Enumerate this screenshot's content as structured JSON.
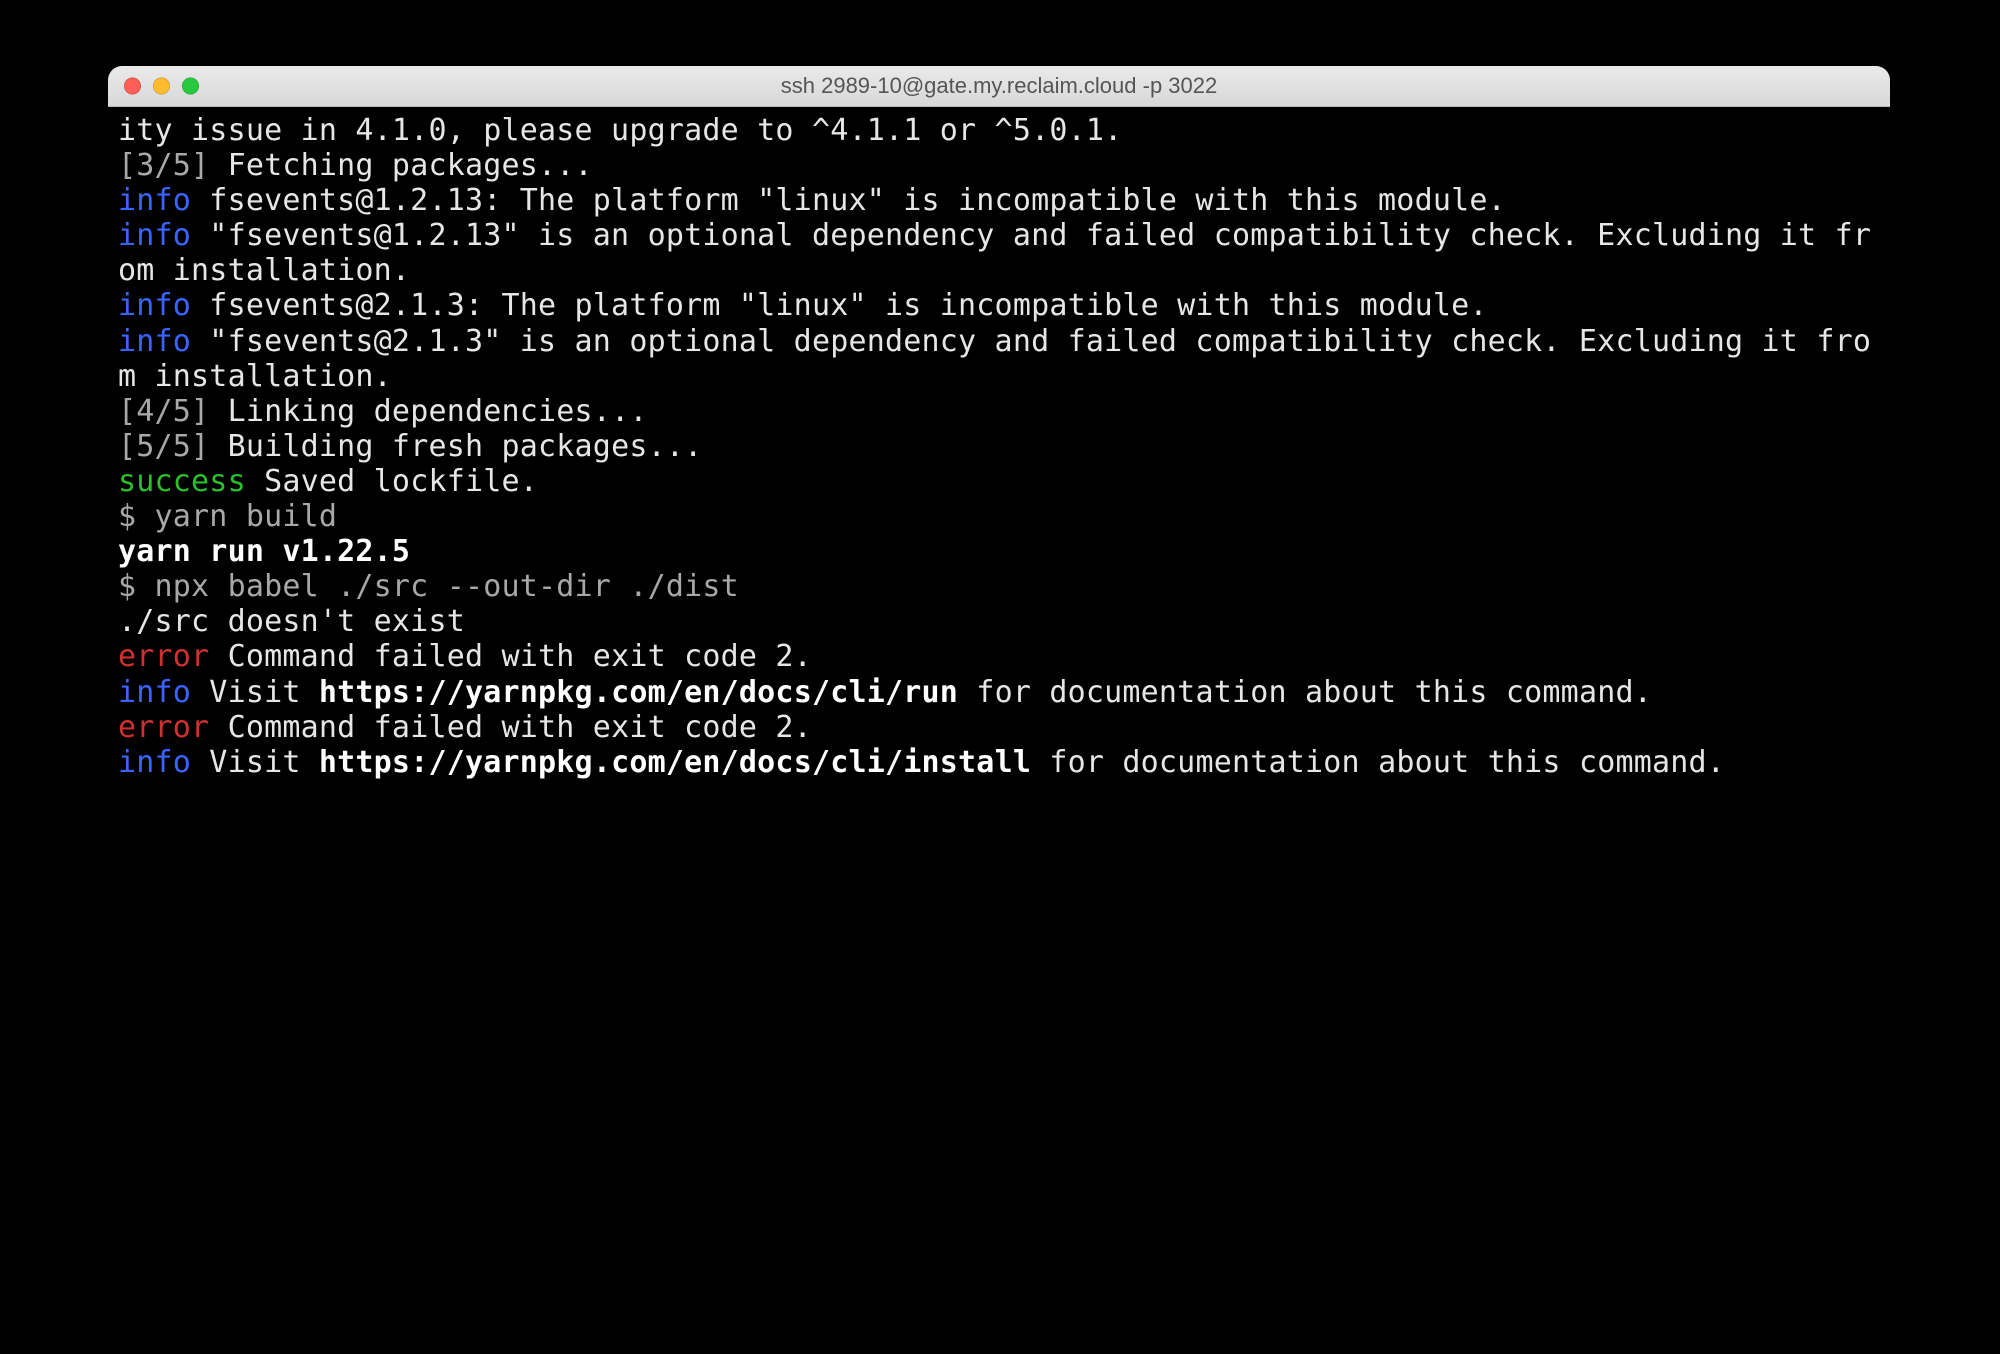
{
  "colors": {
    "bg": "#000000",
    "text": "#e6e6e6",
    "dim": "#a8a8a8",
    "info": "#3a63ff",
    "success": "#2bbf2b",
    "error": "#d03030",
    "bold": "#ffffff"
  },
  "window": {
    "title": "ssh 2989-10@gate.my.reclaim.cloud -p 3022"
  },
  "lines": [
    {
      "spans": [
        {
          "class": "",
          "text": "ity issue in 4.1.0, please upgrade to ^4.1.1 or ^5.0.1."
        }
      ]
    },
    {
      "spans": [
        {
          "class": "dim",
          "text": "[3/5]"
        },
        {
          "class": "",
          "text": " Fetching packages..."
        }
      ]
    },
    {
      "spans": [
        {
          "class": "info",
          "text": "info"
        },
        {
          "class": "",
          "text": " fsevents@1.2.13: The platform \"linux\" is incompatible with this module."
        }
      ]
    },
    {
      "spans": [
        {
          "class": "info",
          "text": "info"
        },
        {
          "class": "",
          "text": " \"fsevents@1.2.13\" is an optional dependency and failed compatibility check. Excluding it from installation."
        }
      ]
    },
    {
      "spans": [
        {
          "class": "info",
          "text": "info"
        },
        {
          "class": "",
          "text": " fsevents@2.1.3: The platform \"linux\" is incompatible with this module."
        }
      ]
    },
    {
      "spans": [
        {
          "class": "info",
          "text": "info"
        },
        {
          "class": "",
          "text": " \"fsevents@2.1.3\" is an optional dependency and failed compatibility check. Excluding it from installation."
        }
      ]
    },
    {
      "spans": [
        {
          "class": "dim",
          "text": "[4/5]"
        },
        {
          "class": "",
          "text": " Linking dependencies..."
        }
      ]
    },
    {
      "spans": [
        {
          "class": "dim",
          "text": "[5/5]"
        },
        {
          "class": "",
          "text": " Building fresh packages..."
        }
      ]
    },
    {
      "spans": [
        {
          "class": "ok",
          "text": "success"
        },
        {
          "class": "",
          "text": " Saved lockfile."
        }
      ]
    },
    {
      "spans": [
        {
          "class": "dim",
          "text": "$ yarn build"
        }
      ]
    },
    {
      "spans": [
        {
          "class": "bold",
          "text": "yarn run v1.22.5"
        }
      ]
    },
    {
      "spans": [
        {
          "class": "dim",
          "text": "$ npx babel ./src --out-dir ./dist"
        }
      ]
    },
    {
      "spans": [
        {
          "class": "",
          "text": "./src doesn't exist"
        }
      ]
    },
    {
      "spans": [
        {
          "class": "err",
          "text": "error"
        },
        {
          "class": "",
          "text": " Command failed with exit code 2."
        }
      ]
    },
    {
      "spans": [
        {
          "class": "info",
          "text": "info"
        },
        {
          "class": "",
          "text": " Visit "
        },
        {
          "class": "bold",
          "text": "https://yarnpkg.com/en/docs/cli/run"
        },
        {
          "class": "",
          "text": " for documentation about this command."
        }
      ]
    },
    {
      "spans": [
        {
          "class": "err",
          "text": "error"
        },
        {
          "class": "",
          "text": " Command failed with exit code 2."
        }
      ]
    },
    {
      "spans": [
        {
          "class": "info",
          "text": "info"
        },
        {
          "class": "",
          "text": " Visit "
        },
        {
          "class": "bold",
          "text": "https://yarnpkg.com/en/docs/cli/install"
        },
        {
          "class": "",
          "text": " for documentation about this command."
        }
      ]
    }
  ]
}
